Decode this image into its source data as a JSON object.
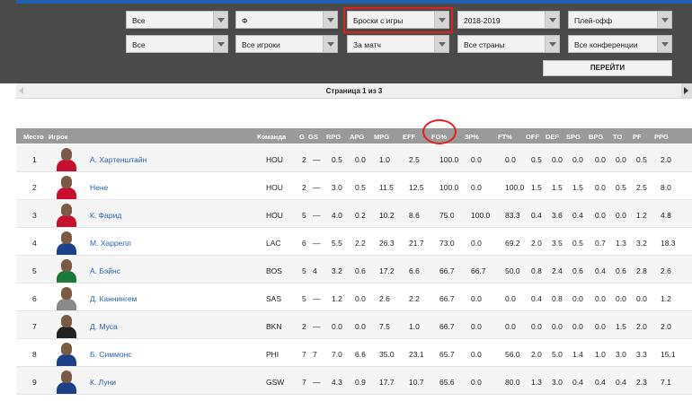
{
  "colors": {
    "header_bg": "#4a4a4a",
    "accent_blue": "#1f5fb0",
    "highlight_red": "#e0201e",
    "table_header_bg": "#9a9a9a",
    "link": "#2a63b0"
  },
  "filters": {
    "row1": [
      "Все",
      "Ф",
      "Броски с игры",
      "2018-2019",
      "Плей-офф"
    ],
    "row2": [
      "Все",
      "Все игроки",
      "За матч",
      "Все страны",
      "Все конференции"
    ],
    "go_label": "ПЕРЕЙТИ"
  },
  "pager": {
    "text": "Страница 1 из 3"
  },
  "table": {
    "headers": [
      "Место",
      "Игрок",
      "Команда",
      "G",
      "GS",
      "RPG",
      "APG",
      "MPG",
      "EFF",
      "FG%",
      "3P%",
      "FT%",
      "OFF",
      "DEF",
      "SPG",
      "BPG",
      "TO",
      "PF",
      "PPG"
    ],
    "rows": [
      [
        "1",
        "А. Хартенштайн",
        "HOU",
        "2",
        "—",
        "0.5",
        "0.0",
        "1.0",
        "2.5",
        "100.0",
        "0.0",
        "0.0",
        "0.5",
        "0.0",
        "0.0",
        "0.0",
        "0.0",
        "0.5",
        "2.0"
      ],
      [
        "2",
        "Нене",
        "HOU",
        "2",
        "—",
        "3.0",
        "0.5",
        "11.5",
        "12.5",
        "100.0",
        "0.0",
        "100.0",
        "1.5",
        "1.5",
        "1.5",
        "0.0",
        "0.5",
        "2.5",
        "8.0"
      ],
      [
        "3",
        "К. Фарид",
        "HOU",
        "5",
        "—",
        "4.0",
        "0.2",
        "10.2",
        "8.6",
        "75.0",
        "100.0",
        "83.3",
        "0.4",
        "3.6",
        "0.4",
        "0.0",
        "0.0",
        "1.2",
        "4.8"
      ],
      [
        "4",
        "М. Харрелл",
        "LAC",
        "6",
        "—",
        "5.5",
        "2.2",
        "26.3",
        "21.7",
        "73.0",
        "0.0",
        "69.2",
        "2.0",
        "3.5",
        "0.5",
        "0.7",
        "1.3",
        "3.2",
        "18.3"
      ],
      [
        "5",
        "А. Бэйнс",
        "BOS",
        "5",
        "4",
        "3.2",
        "0.6",
        "17.2",
        "6.6",
        "66.7",
        "66.7",
        "50.0",
        "0.8",
        "2.4",
        "0.6",
        "0.4",
        "0.6",
        "2.8",
        "2.6"
      ],
      [
        "6",
        "Д. Каннингем",
        "SAS",
        "5",
        "—",
        "1.2",
        "0.0",
        "2.6",
        "2.2",
        "66.7",
        "0.0",
        "0.0",
        "0.4",
        "0.8",
        "0.0",
        "0.0",
        "0.0",
        "0.0",
        "1.2"
      ],
      [
        "7",
        "Д. Муса",
        "BKN",
        "2",
        "—",
        "0.0",
        "0.0",
        "7.5",
        "1.0",
        "66.7",
        "0.0",
        "0.0",
        "0.0",
        "0.0",
        "0.0",
        "0.0",
        "1.5",
        "2.0",
        "2.0"
      ],
      [
        "8",
        "Б. Симмонс",
        "PHI",
        "7",
        "7",
        "7.0",
        "6.6",
        "35.0",
        "23.1",
        "65.7",
        "0.0",
        "56.0",
        "2.0",
        "5.0",
        "1.4",
        "1.0",
        "3.0",
        "3.3",
        "15.1"
      ],
      [
        "9",
        "К. Луни",
        "GSW",
        "7",
        "—",
        "4.3",
        "0.9",
        "17.7",
        "10.7",
        "65.6",
        "0.0",
        "80.0",
        "1.3",
        "3.0",
        "0.4",
        "0.4",
        "0.4",
        "2.3",
        "7.1"
      ]
    ],
    "jersey_colors": [
      "#c8102e",
      "#c8102e",
      "#c8102e",
      "#1d428a",
      "#1a7a3a",
      "#8a8a8a",
      "#222222",
      "#1d428a",
      "#1d428a"
    ]
  }
}
